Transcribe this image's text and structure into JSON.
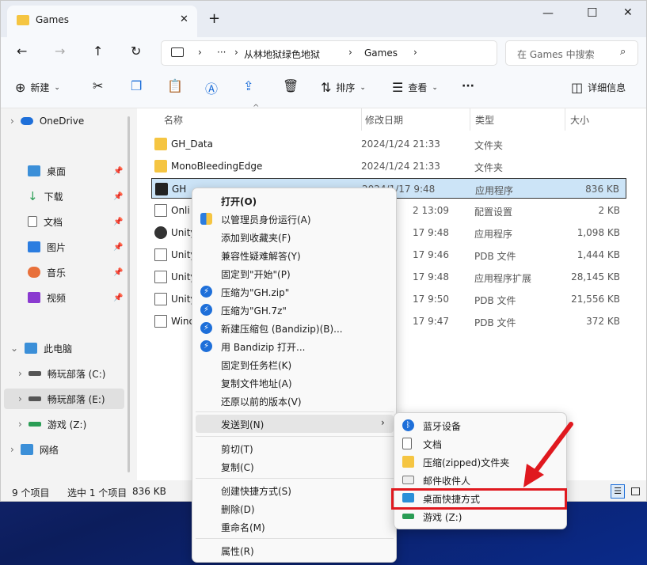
{
  "window": {
    "tab_title": "Games",
    "new_tab": "+",
    "minimize": "—",
    "maximize": "☐",
    "close": "✕"
  },
  "address": {
    "more": "···",
    "crumbs": [
      "从林地狱绿色地狱",
      "Games"
    ],
    "search_placeholder": "在 Games 中搜索"
  },
  "toolbar": {
    "new_label": "新建",
    "sort_label": "排序",
    "view_label": "查看",
    "more": "···",
    "details_label": "详细信息"
  },
  "nav": {
    "items": [
      "OneDrive",
      "桌面",
      "下载",
      "文档",
      "图片",
      "音乐",
      "视频",
      "此电脑",
      "畅玩部落 (C:)",
      "畅玩部落 (E:)",
      "游戏 (Z:)",
      "网络"
    ]
  },
  "columns": {
    "name": "名称",
    "date": "修改日期",
    "type": "类型",
    "size": "大小"
  },
  "files": [
    {
      "name": "GH_Data",
      "date": "2024/1/24 21:33",
      "type": "文件夹",
      "size": ""
    },
    {
      "name": "MonoBleedingEdge",
      "date": "2024/1/24 21:33",
      "type": "文件夹",
      "size": ""
    },
    {
      "name": "GH",
      "date": "2024/1/17 9:48",
      "type": "应用程序",
      "size": "836 KB"
    },
    {
      "name": "Onli",
      "date": "2 13:09",
      "type": "配置设置",
      "size": "2 KB"
    },
    {
      "name": "Unity",
      "date": "17 9:48",
      "type": "应用程序",
      "size": "1,098 KB"
    },
    {
      "name": "Unity",
      "date": "17 9:46",
      "type": "PDB 文件",
      "size": "1,444 KB"
    },
    {
      "name": "Unity",
      "date": "17 9:48",
      "type": "应用程序扩展",
      "size": "28,145 KB"
    },
    {
      "name": "Unity",
      "date": "17 9:50",
      "type": "PDB 文件",
      "size": "21,556 KB"
    },
    {
      "name": "Winc",
      "date": "17 9:47",
      "type": "PDB 文件",
      "size": "372 KB"
    }
  ],
  "status": {
    "count": "9 个项目",
    "selected": "选中 1 个项目",
    "size": "836 KB"
  },
  "context_menu": [
    "打开(O)",
    "以管理员身份运行(A)",
    "添加到收藏夹(F)",
    "兼容性疑难解答(Y)",
    "固定到\"开始\"(P)",
    "压缩为\"GH.zip\"",
    "压缩为\"GH.7z\"",
    "新建压缩包 (Bandizip)(B)...",
    "用 Bandizip 打开...",
    "固定到任务栏(K)",
    "复制文件地址(A)",
    "还原以前的版本(V)",
    "发送到(N)",
    "剪切(T)",
    "复制(C)",
    "创建快捷方式(S)",
    "删除(D)",
    "重命名(M)",
    "属性(R)"
  ],
  "send_to": [
    "蓝牙设备",
    "文档",
    "压缩(zipped)文件夹",
    "邮件收件人",
    "桌面快捷方式",
    "游戏 (Z:)"
  ],
  "colors": {
    "accent": "#1e6fd9",
    "highlight_box": "#e0191f",
    "selected_row": "#cce4f7"
  }
}
